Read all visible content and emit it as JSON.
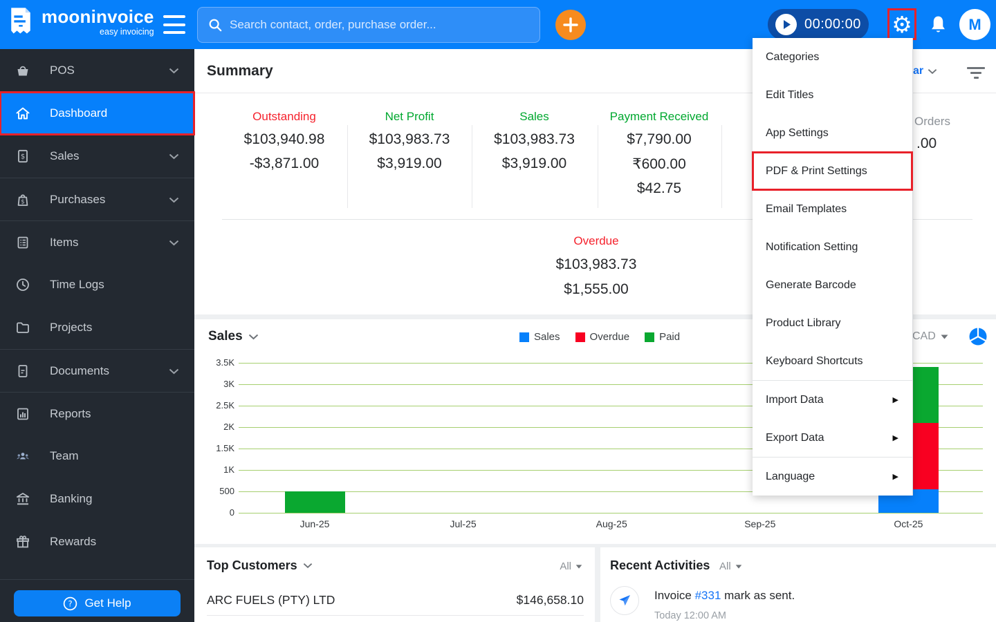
{
  "topbar": {
    "brand": "mooninvoice",
    "brand_tagline": "easy invoicing",
    "search_placeholder": "Search contact, order, purchase order...",
    "timer": "00:00:00",
    "avatar_initial": "M"
  },
  "sidebar": {
    "items": [
      {
        "label": "POS",
        "expandable": true
      },
      {
        "label": "Dashboard",
        "active": true
      },
      {
        "label": "Sales",
        "expandable": true
      },
      {
        "label": "Purchases",
        "expandable": true
      },
      {
        "label": "Items",
        "expandable": true
      },
      {
        "label": "Time Logs"
      },
      {
        "label": "Projects"
      },
      {
        "label": "Documents",
        "expandable": true
      },
      {
        "label": "Reports"
      },
      {
        "label": "Team"
      },
      {
        "label": "Banking"
      },
      {
        "label": "Rewards"
      }
    ],
    "get_help_label": "Get Help"
  },
  "summary": {
    "title": "Summary",
    "period_fragment": "ar",
    "stats": [
      {
        "label": "Outstanding",
        "color": "#f5222d",
        "line1": "$103,940.98",
        "line2": "-$3,871.00"
      },
      {
        "label": "Net Profit",
        "color": "#00a82f",
        "line1": "$103,983.73",
        "line2": "$3,919.00"
      },
      {
        "label": "Sales",
        "color": "#00a82f",
        "line1": "$103,983.73",
        "line2": "$3,919.00"
      },
      {
        "label": "Payment Received",
        "color": "#00a82f",
        "line1": "$7,790.00",
        "line2": "₹600.00",
        "line3": "$42.75"
      }
    ],
    "partial_column": {
      "label_fragment": "Orders",
      "value_fragment": ".00"
    },
    "overdue": {
      "label": "Overdue",
      "line1": "$103,983.73",
      "line2": "$1,555.00"
    }
  },
  "settings_menu": {
    "items": [
      {
        "label": "Categories"
      },
      {
        "label": "Edit Titles"
      },
      {
        "label": "App Settings"
      },
      {
        "label": "PDF & Print Settings",
        "highlighted": true
      },
      {
        "label": "Email Templates"
      },
      {
        "label": "Notification Setting"
      },
      {
        "label": "Generate Barcode"
      },
      {
        "label": "Product Library"
      },
      {
        "label": "Keyboard Shortcuts"
      },
      {
        "label": "Import Data",
        "has_submenu": true
      },
      {
        "label": "Export Data",
        "has_submenu": true
      },
      {
        "label": "Language",
        "has_submenu": true
      }
    ]
  },
  "sales_section": {
    "title": "Sales",
    "currency": "CAD",
    "chart_data": {
      "type": "bar",
      "stacked": true,
      "categories": [
        "Jun-25",
        "Jul-25",
        "Aug-25",
        "Sep-25",
        "Oct-25"
      ],
      "series": [
        {
          "name": "Sales",
          "color": "#0680fb",
          "values": [
            0,
            0,
            0,
            0,
            550
          ]
        },
        {
          "name": "Overdue",
          "color": "#f80021",
          "values": [
            0,
            0,
            0,
            0,
            1550
          ]
        },
        {
          "name": "Paid",
          "color": "#0aa830",
          "values": [
            500,
            0,
            0,
            0,
            1300
          ]
        }
      ],
      "ylim": [
        0,
        3500
      ],
      "ytick_labels": [
        "0",
        "500",
        "1K",
        "1.5K",
        "2K",
        "2.5K",
        "3K",
        "3.5K"
      ],
      "grid": true,
      "legend_position": "top"
    }
  },
  "top_customers": {
    "title": "Top Customers",
    "filter": "All",
    "rows": [
      {
        "name": "ARC FUELS (PTY) LTD",
        "amount": "$146,658.10"
      }
    ]
  },
  "recent_activities": {
    "title": "Recent Activities",
    "filter": "All",
    "items": [
      {
        "prefix": "Invoice ",
        "link": "#331",
        "suffix": " mark as sent.",
        "detail": "Today 12:00 AM"
      }
    ]
  },
  "colors": {
    "topbar_blue": "#0680fb",
    "accent_orange": "#f78b1e",
    "highlight_red": "#e8212a",
    "negative_red": "#f5222d",
    "positive_green": "#00a82f",
    "link_blue": "#1574f6",
    "gridline_green": "#a6cf6f"
  }
}
